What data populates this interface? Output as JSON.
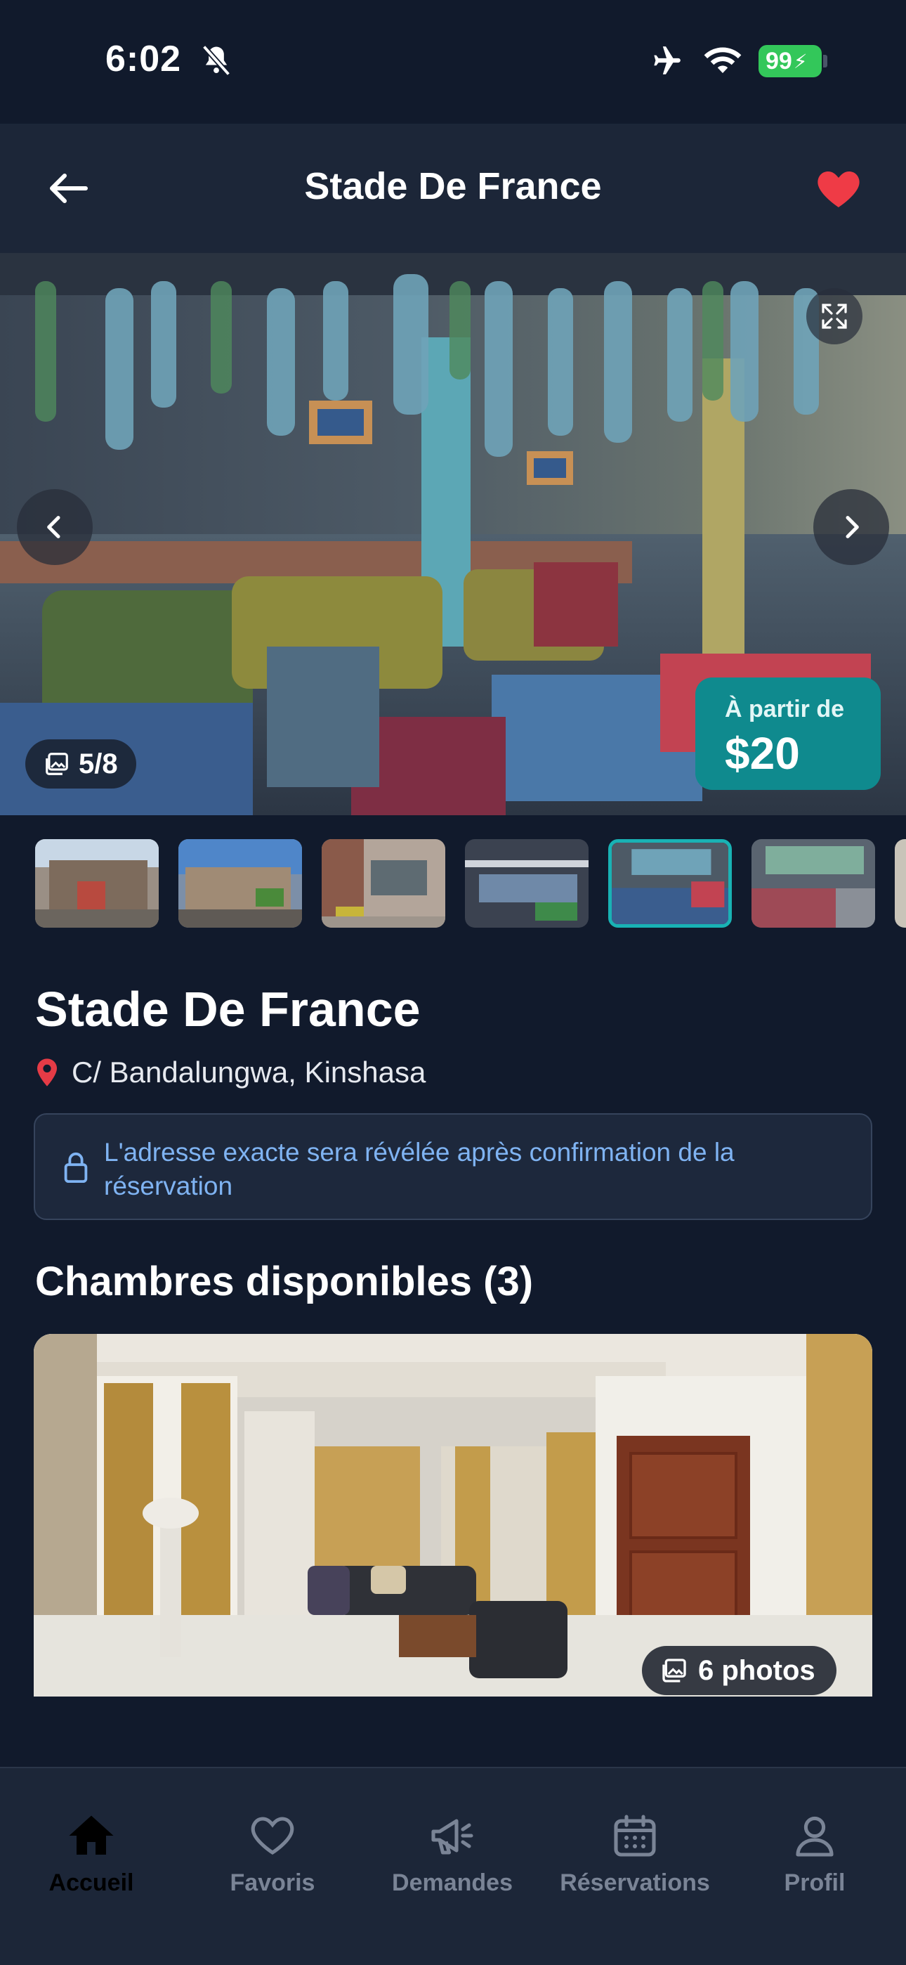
{
  "status_bar": {
    "time": "6:02",
    "battery": "99"
  },
  "header": {
    "title": "Stade De France"
  },
  "gallery": {
    "counter": "5/8",
    "price_label": "À partir de",
    "price_value": "$20"
  },
  "property": {
    "title": "Stade De France",
    "location": "C/ Bandalungwa, Kinshasa",
    "notice": "L'adresse exacte sera révélée après confirmation de la réservation"
  },
  "rooms": {
    "section_title": "Chambres disponibles (3)",
    "photos_label": "6 photos"
  },
  "tabs": [
    {
      "label": "Accueil",
      "icon": "home-icon",
      "active": true
    },
    {
      "label": "Favoris",
      "icon": "heart-icon"
    },
    {
      "label": "Demandes",
      "icon": "megaphone-icon"
    },
    {
      "label": "Réservations",
      "icon": "calendar-icon"
    },
    {
      "label": "Profil",
      "icon": "user-icon"
    }
  ],
  "colors": {
    "background": "#111a2c",
    "header": "#1c2638",
    "accent": "#0f8a8e",
    "favorite": "#ef3b46",
    "notice_text": "#7fb3f2"
  }
}
